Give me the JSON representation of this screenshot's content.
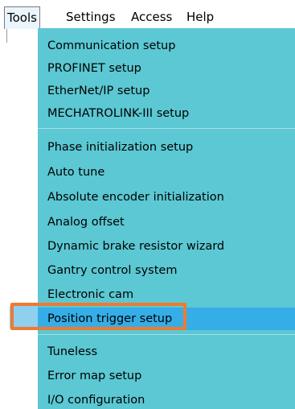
{
  "menubar": {
    "items": [
      {
        "label": "Tools",
        "active": true
      },
      {
        "label": "Settings"
      },
      {
        "label": "Access"
      },
      {
        "label": "Help"
      }
    ]
  },
  "dropdown": {
    "background_color": "#5bc8d3",
    "highlight_color": "#35aee8",
    "callout_color": "#ee7a33",
    "groups": [
      [
        "Communication setup",
        "PROFINET setup",
        "EtherNet/IP setup",
        "MECHATROLINK-III setup"
      ],
      [
        "Phase initialization setup",
        "Auto tune",
        "Absolute encoder initialization",
        "Analog offset",
        "Dynamic brake resistor wizard",
        "Gantry control system",
        "Electronic cam",
        "Position trigger setup"
      ],
      [
        "Tuneless",
        "Error map setup",
        "I/O configuration"
      ]
    ],
    "highlighted_item": "Position trigger setup"
  }
}
